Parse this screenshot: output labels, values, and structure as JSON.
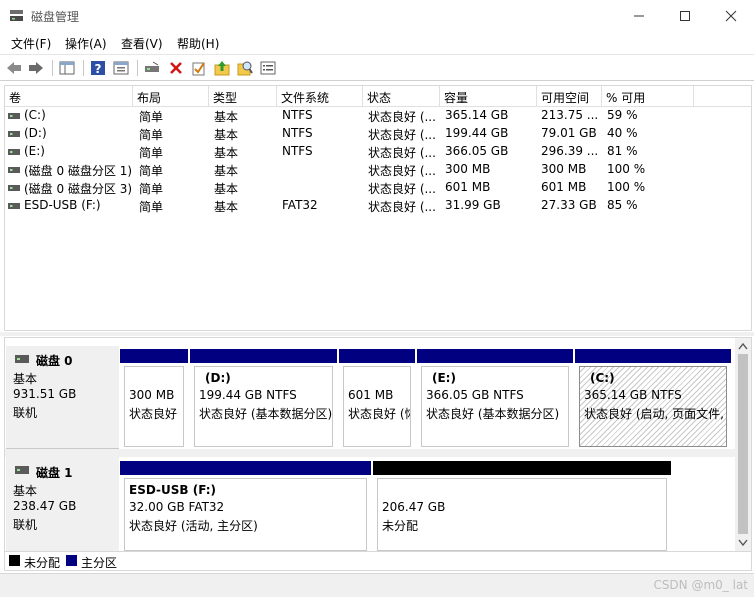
{
  "window": {
    "title": "磁盘管理"
  },
  "menu": [
    "文件(F)",
    "操作(A)",
    "查看(V)",
    "帮助(H)"
  ],
  "toolbar": {
    "icons": [
      "back-arrow-icon",
      "forward-arrow-icon",
      "console-tree-icon",
      "help-icon",
      "properties-icon",
      "connect-disk-icon",
      "delete-icon",
      "check-icon",
      "up-folder-icon",
      "search-icon",
      "list-icon"
    ]
  },
  "columns": [
    "卷",
    "布局",
    "类型",
    "文件系统",
    "状态",
    "容量",
    "可用空间",
    "% 可用"
  ],
  "volumes": [
    {
      "name": "(C:)",
      "layout": "简单",
      "type": "基本",
      "fs": "NTFS",
      "status": "状态良好 (...",
      "capacity": "365.14 GB",
      "free": "213.75 ...",
      "pct": "59 %"
    },
    {
      "name": "(D:)",
      "layout": "简单",
      "type": "基本",
      "fs": "NTFS",
      "status": "状态良好 (...",
      "capacity": "199.44 GB",
      "free": "79.01 GB",
      "pct": "40 %"
    },
    {
      "name": "(E:)",
      "layout": "简单",
      "type": "基本",
      "fs": "NTFS",
      "status": "状态良好 (...",
      "capacity": "366.05 GB",
      "free": "296.39 ...",
      "pct": "81 %"
    },
    {
      "name": "(磁盘 0 磁盘分区 1)",
      "layout": "简单",
      "type": "基本",
      "fs": "",
      "status": "状态良好 (...",
      "capacity": "300 MB",
      "free": "300 MB",
      "pct": "100 %"
    },
    {
      "name": "(磁盘 0 磁盘分区 3)",
      "layout": "简单",
      "type": "基本",
      "fs": "",
      "status": "状态良好 (...",
      "capacity": "601 MB",
      "free": "601 MB",
      "pct": "100 %"
    },
    {
      "name": "ESD-USB (F:)",
      "layout": "简单",
      "type": "基本",
      "fs": "FAT32",
      "status": "状态良好 (...",
      "capacity": "31.99 GB",
      "free": "27.33 GB",
      "pct": "85 %"
    }
  ],
  "disks": [
    {
      "name": "磁盘 0",
      "kind": "基本",
      "size": "931.51 GB",
      "state": "联机",
      "partitions": [
        {
          "title": "",
          "line1": "300 MB",
          "line2": "状态良好",
          "bar_color": "#000080"
        },
        {
          "title": "(D:)",
          "line1": "199.44 GB NTFS",
          "line2": "状态良好 (基本数据分区)",
          "bar_color": "#000080"
        },
        {
          "title": "",
          "line1": "601 MB",
          "line2": "状态良好 (恢",
          "bar_color": "#000080"
        },
        {
          "title": "(E:)",
          "line1": "366.05 GB NTFS",
          "line2": "状态良好 (基本数据分区)",
          "bar_color": "#000080"
        },
        {
          "title": "(C:)",
          "line1": "365.14 GB NTFS",
          "line2": "状态良好 (启动, 页面文件, 故",
          "bar_color": "#000080"
        }
      ]
    },
    {
      "name": "磁盘 1",
      "kind": "基本",
      "size": "238.47 GB",
      "state": "联机",
      "partitions": [
        {
          "title": "ESD-USB (F:)",
          "line1": "32.00 GB FAT32",
          "line2": "状态良好 (活动, 主分区)",
          "bar_color": "#000080"
        },
        {
          "title": "",
          "line1": "206.47 GB",
          "line2": "未分配",
          "bar_color": "#000000"
        }
      ]
    }
  ],
  "legend": [
    {
      "label": "未分配",
      "color": "#000000"
    },
    {
      "label": "主分区",
      "color": "#000080"
    }
  ],
  "watermark": "CSDN @m0_  lat"
}
